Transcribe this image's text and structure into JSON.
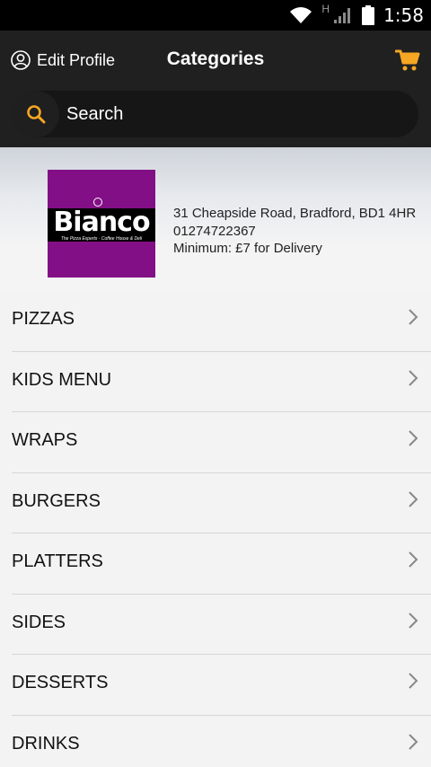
{
  "status_bar": {
    "network_label": "H",
    "time": "1:58"
  },
  "header": {
    "edit_profile_label": "Edit Profile",
    "title": "Categories"
  },
  "search": {
    "placeholder": "Search"
  },
  "restaurant": {
    "logo_text": "Bianco",
    "logo_tagline": "The Pizza Experts · Coffee House & Deli",
    "address": "31 Cheapside Road, Bradford, BD1 4HR",
    "phone": "01274722367",
    "minimum": "Minimum: £7 for Delivery"
  },
  "categories": [
    {
      "label": "PIZZAS"
    },
    {
      "label": "KIDS MENU"
    },
    {
      "label": "WRAPS"
    },
    {
      "label": "BURGERS"
    },
    {
      "label": "PLATTERS"
    },
    {
      "label": "SIDES"
    },
    {
      "label": "DESSERTS"
    },
    {
      "label": "DRINKS"
    }
  ],
  "colors": {
    "accent": "#f5a623",
    "header_bg": "#202020",
    "logo_bg": "#830f86"
  }
}
